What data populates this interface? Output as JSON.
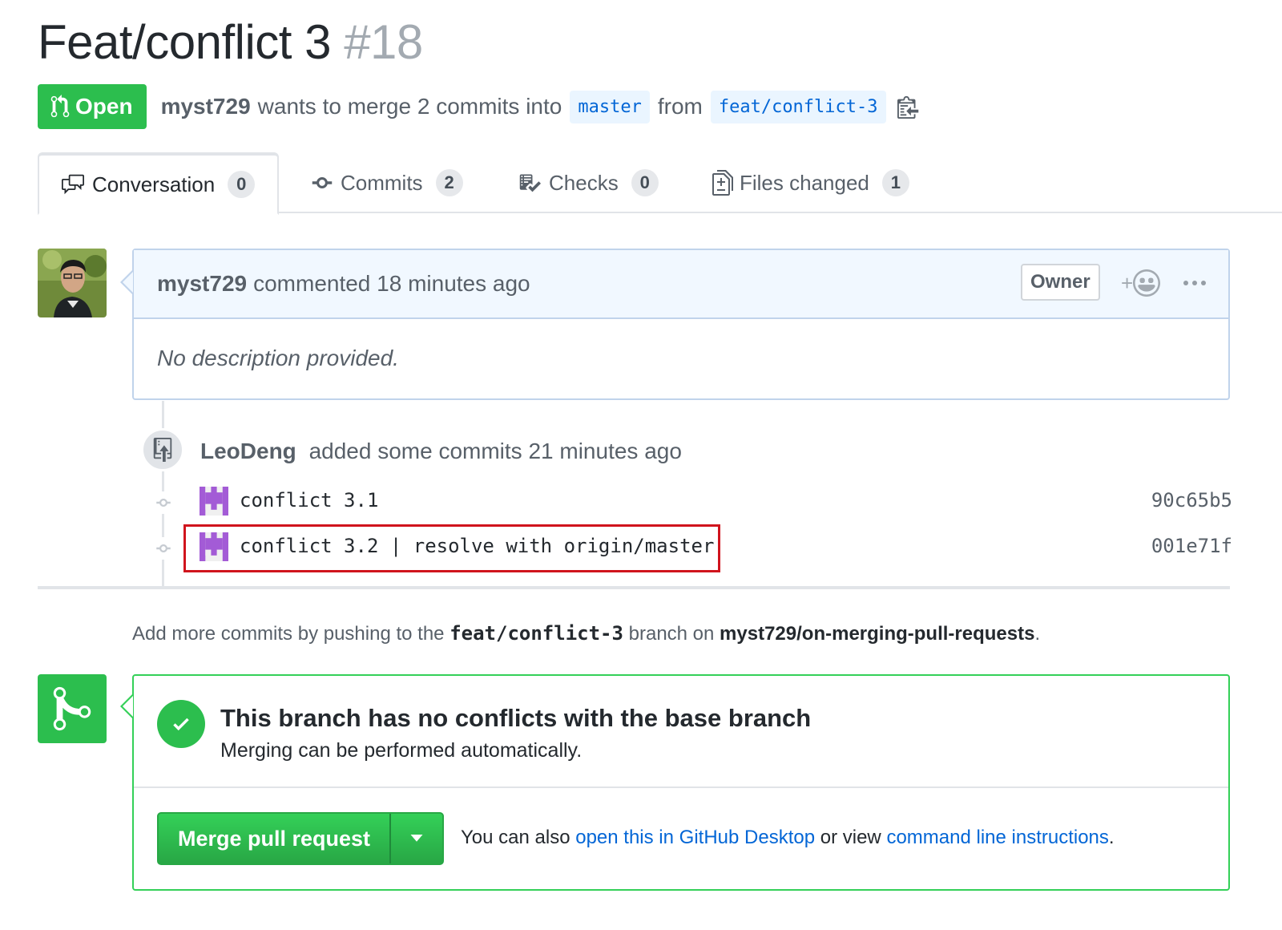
{
  "header": {
    "title": "Feat/conflict 3",
    "number": "#18"
  },
  "meta": {
    "state": "Open",
    "author": "myst729",
    "action": "wants to merge 2 commits into",
    "base_branch": "master",
    "from_word": "from",
    "head_branch": "feat/conflict-3"
  },
  "tabs": [
    {
      "label": "Conversation",
      "count": "0",
      "icon": "comment-discussion-icon",
      "selected": true
    },
    {
      "label": "Commits",
      "count": "2",
      "icon": "git-commit-icon",
      "selected": false
    },
    {
      "label": "Checks",
      "count": "0",
      "icon": "checklist-icon",
      "selected": false
    },
    {
      "label": "Files changed",
      "count": "1",
      "icon": "diff-icon",
      "selected": false
    }
  ],
  "comment": {
    "author": "myst729",
    "action": "commented 18 minutes ago",
    "badge": "Owner",
    "reaction": "+",
    "body": "No description provided."
  },
  "timeline": {
    "push_author": "LeoDeng",
    "push_action": "added some commits 21 minutes ago",
    "commits": [
      {
        "message": "conflict 3.1",
        "sha": "90c65b5"
      },
      {
        "message": "conflict 3.2 | resolve with origin/master",
        "sha": "001e71f"
      }
    ]
  },
  "push_hint": {
    "prefix": "Add more commits by pushing to the",
    "branch": "feat/conflict-3",
    "middle": "branch on",
    "repo": "myst729/on-merging-pull-requests",
    "suffix": "."
  },
  "merge": {
    "heading": "This branch has no conflicts with the base branch",
    "subheading": "Merging can be performed automatically.",
    "button_label": "Merge pull request",
    "hint_prefix": "You can also",
    "desktop_link": "open this in GitHub Desktop",
    "hint_middle": "or view",
    "cli_link": "command line instructions",
    "hint_suffix": "."
  },
  "colors": {
    "success_green": "#2cbe4e",
    "link_blue": "#0366d6",
    "highlight_red": "#d0141d",
    "comment_header_bg": "#f1f8ff"
  }
}
